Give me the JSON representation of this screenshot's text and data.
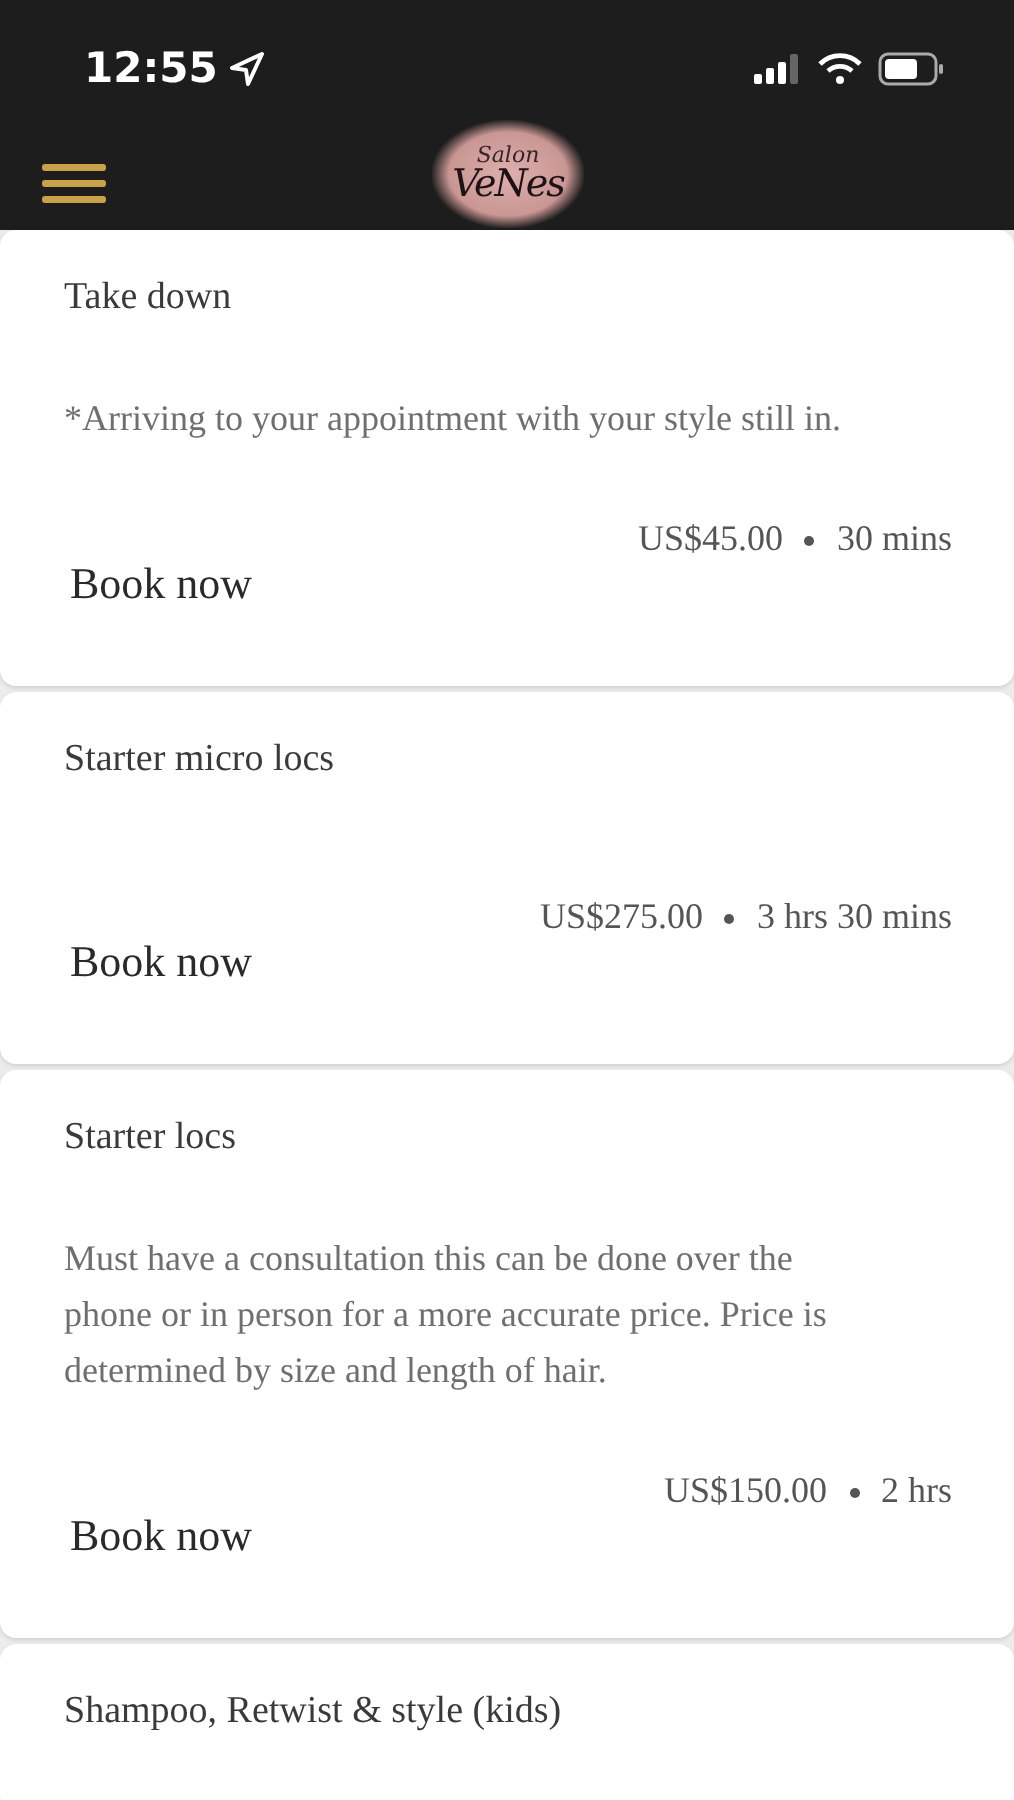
{
  "status_bar": {
    "time": "12:55"
  },
  "header": {
    "logo_top": "Salon",
    "logo_main": "VeNes"
  },
  "services": [
    {
      "title": "Take down",
      "description": "*Arriving to your appointment with your style still in.",
      "price": "US$45.00",
      "duration": "30 mins",
      "action": "Book now"
    },
    {
      "title": "Starter micro locs",
      "price": "US$275.00",
      "duration": "3 hrs 30 mins",
      "action": "Book now"
    },
    {
      "title": "Starter locs",
      "description": "Must have a consultation this can be done over the phone or in person for a more accurate price. Price is determined by size and length of hair.",
      "price": "US$150.00",
      "duration": "2 hrs",
      "action": "Book now"
    },
    {
      "title": "Shampoo, Retwist & style (kids)"
    }
  ]
}
